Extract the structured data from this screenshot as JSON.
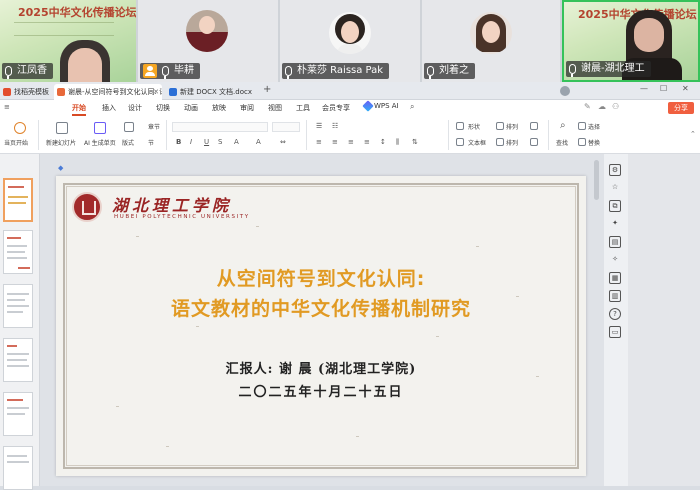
{
  "video_strip": {
    "participants": [
      {
        "name": "江凤香",
        "banner_title": "2025中华文化传播论坛"
      },
      {
        "name": "毕耕"
      },
      {
        "name": "朴莱莎 Raissa Pak"
      },
      {
        "name": "刘着之"
      },
      {
        "name": "谢晨-湖北理工",
        "banner_title": "2025中华文化传播论坛"
      }
    ]
  },
  "tabs": [
    {
      "label": "找稻壳模板"
    },
    {
      "label": "谢晨-从空间符号到文化认同: 语"
    },
    {
      "label": "新建 DOCX 文档.docx"
    }
  ],
  "menu": {
    "items": [
      "开始",
      "插入",
      "设计",
      "切换",
      "动画",
      "放映",
      "审阅",
      "视图",
      "工具",
      "会员专享"
    ],
    "wps_ai": "WPS AI",
    "share": "分享"
  },
  "ribbon": {
    "current_start": "当页开始",
    "new_slide": "新建幻灯片",
    "ai_generate": "AI 生成单页",
    "layout": "版式",
    "section": "章节",
    "section2": "节",
    "shape": "形状",
    "arrange": "排列",
    "textbox": "文本框",
    "arrange2": "排列",
    "find": "查找",
    "select": "选择",
    "replace": "替换"
  },
  "slide": {
    "logo_text": "湖北理工学院",
    "logo_sub": "HUBEI POLYTECHNIC UNIVERSITY",
    "title_line1": "从空间符号到文化认同:",
    "title_line2": "语文教材的中华文化传播机制研究",
    "presenter": "汇报人: 谢 晨 (湖北理工学院)",
    "date": "二〇二五年十月二十五日"
  },
  "colors": {
    "accent": "#d84a24",
    "title": "#e19a23",
    "logo": "#9a2424",
    "share": "#f05f3f"
  }
}
